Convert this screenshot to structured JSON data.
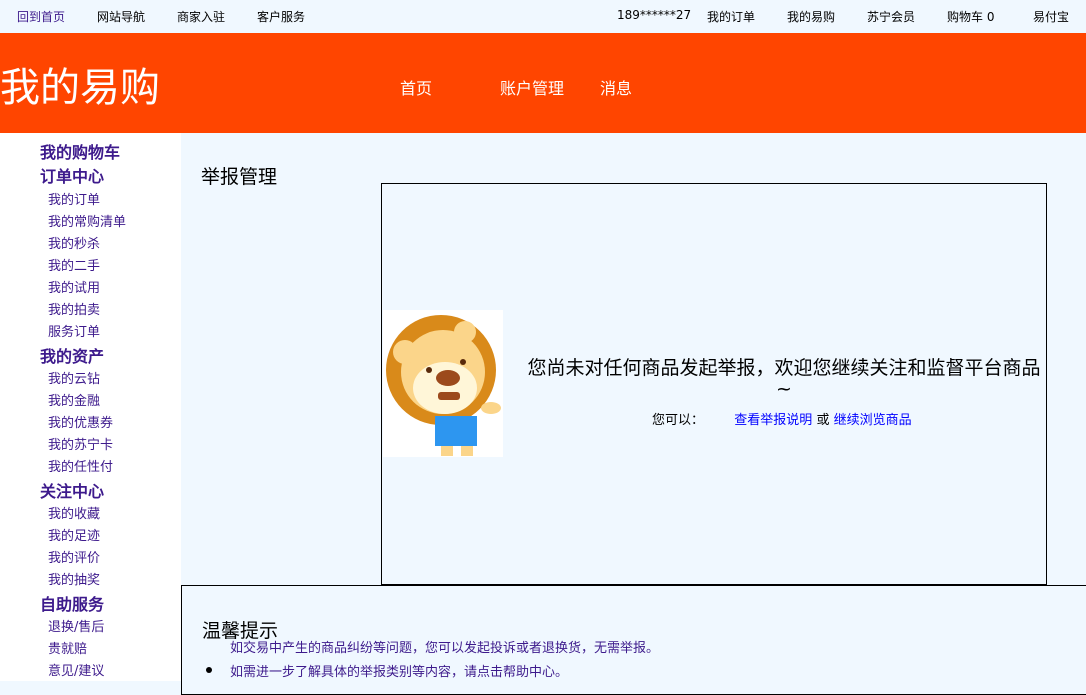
{
  "topbar": {
    "left": [
      "回到首页",
      "网站导航",
      "商家入驻",
      "客户服务"
    ],
    "user": "189******27",
    "right": [
      "我的订单",
      "我的易购",
      "苏宁会员",
      "购物车 0",
      "易付宝"
    ]
  },
  "header": {
    "logo": "我的易购",
    "nav": [
      "首页",
      "账户管理",
      "消息"
    ]
  },
  "sidebar": [
    {
      "t": "h",
      "label": "我的购物车"
    },
    {
      "t": "h",
      "label": "订单中心"
    },
    {
      "t": "i",
      "label": "我的订单"
    },
    {
      "t": "i",
      "label": "我的常购清单"
    },
    {
      "t": "i",
      "label": "我的秒杀"
    },
    {
      "t": "i",
      "label": "我的二手"
    },
    {
      "t": "i",
      "label": "我的试用"
    },
    {
      "t": "i",
      "label": "我的拍卖"
    },
    {
      "t": "i",
      "label": "服务订单"
    },
    {
      "t": "h",
      "label": "我的资产"
    },
    {
      "t": "i",
      "label": "我的云钻"
    },
    {
      "t": "i",
      "label": "我的金融"
    },
    {
      "t": "i",
      "label": "我的优惠券"
    },
    {
      "t": "i",
      "label": "我的苏宁卡"
    },
    {
      "t": "i",
      "label": "我的任性付"
    },
    {
      "t": "h",
      "label": "关注中心"
    },
    {
      "t": "i",
      "label": "我的收藏"
    },
    {
      "t": "i",
      "label": "我的足迹"
    },
    {
      "t": "i",
      "label": "我的评价"
    },
    {
      "t": "i",
      "label": "我的抽奖"
    },
    {
      "t": "h",
      "label": "自助服务"
    },
    {
      "t": "i",
      "label": "退换/售后"
    },
    {
      "t": "i",
      "label": "贵就赔"
    },
    {
      "t": "i",
      "label": "意见/建议"
    }
  ],
  "main": {
    "title": "举报管理",
    "empty_message": "您尚未对任何商品发起举报，欢迎您继续关注和监督平台商品~",
    "you_can": "您可以：",
    "link1": "查看举报说明",
    "or": " 或 ",
    "link2": "继续浏览商品"
  },
  "tips": {
    "title": "温馨提示",
    "line1": "如交易中产生的商品纠纷等问题，您可以发起投诉或者退换货，无需举报。",
    "line2": "如需进一步了解具体的举报类别等内容，请点击帮助中心。"
  }
}
